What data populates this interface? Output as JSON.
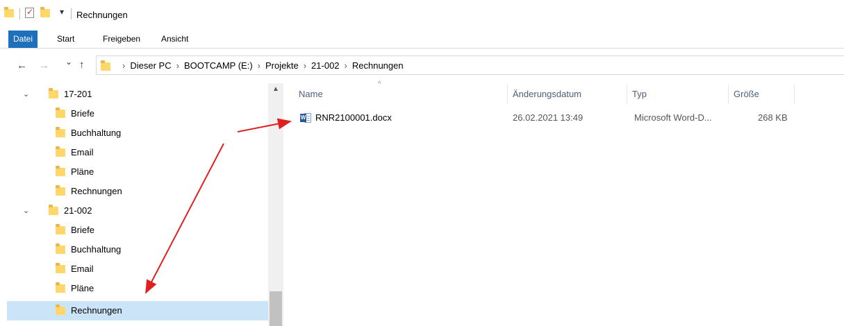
{
  "window": {
    "title": "Rechnungen",
    "qa_dropdown_glyph": "▾"
  },
  "ribbon": {
    "tabs": [
      "Datei",
      "Start",
      "Freigeben",
      "Ansicht"
    ],
    "active_tab": "Datei",
    "accent_color": "#1e6fbc"
  },
  "address": {
    "back_glyph": "←",
    "forward_glyph": "→",
    "recent_glyph": "⌄",
    "up_glyph": "↑",
    "breadcrumbs": [
      "Dieser PC",
      "BOOTCAMP (E:)",
      "Projekte",
      "21-002",
      "Rechnungen"
    ],
    "separator_glyph": "›"
  },
  "tree": {
    "items": [
      {
        "label": "17-201",
        "level": 0,
        "expanded": true,
        "selected": false
      },
      {
        "label": "Briefe",
        "level": 1,
        "selected": false
      },
      {
        "label": "Buchhaltung",
        "level": 1,
        "selected": false
      },
      {
        "label": "Email",
        "level": 1,
        "selected": false
      },
      {
        "label": "Pläne",
        "level": 1,
        "selected": false
      },
      {
        "label": "Rechnungen",
        "level": 1,
        "selected": false
      },
      {
        "label": "21-002",
        "level": 0,
        "expanded": true,
        "selected": false
      },
      {
        "label": "Briefe",
        "level": 1,
        "selected": false
      },
      {
        "label": "Buchhaltung",
        "level": 1,
        "selected": false
      },
      {
        "label": "Email",
        "level": 1,
        "selected": false
      },
      {
        "label": "Pläne",
        "level": 1,
        "selected": false
      },
      {
        "label": "Rechnungen",
        "level": 1,
        "selected": true
      }
    ],
    "expander_glyph": "⌄",
    "selection_color": "#cce4f7"
  },
  "columns": {
    "name": "Name",
    "date": "Änderungsdatum",
    "type": "Typ",
    "size": "Größe",
    "sort_glyph": "^"
  },
  "files": [
    {
      "name": "RNR2100001.docx",
      "date": "26.02.2021 13:49",
      "type": "Microsoft Word-D...",
      "size": "268 KB",
      "icon": "word-document-icon"
    }
  ],
  "annotations": {
    "arrow_color": "#e02020"
  }
}
